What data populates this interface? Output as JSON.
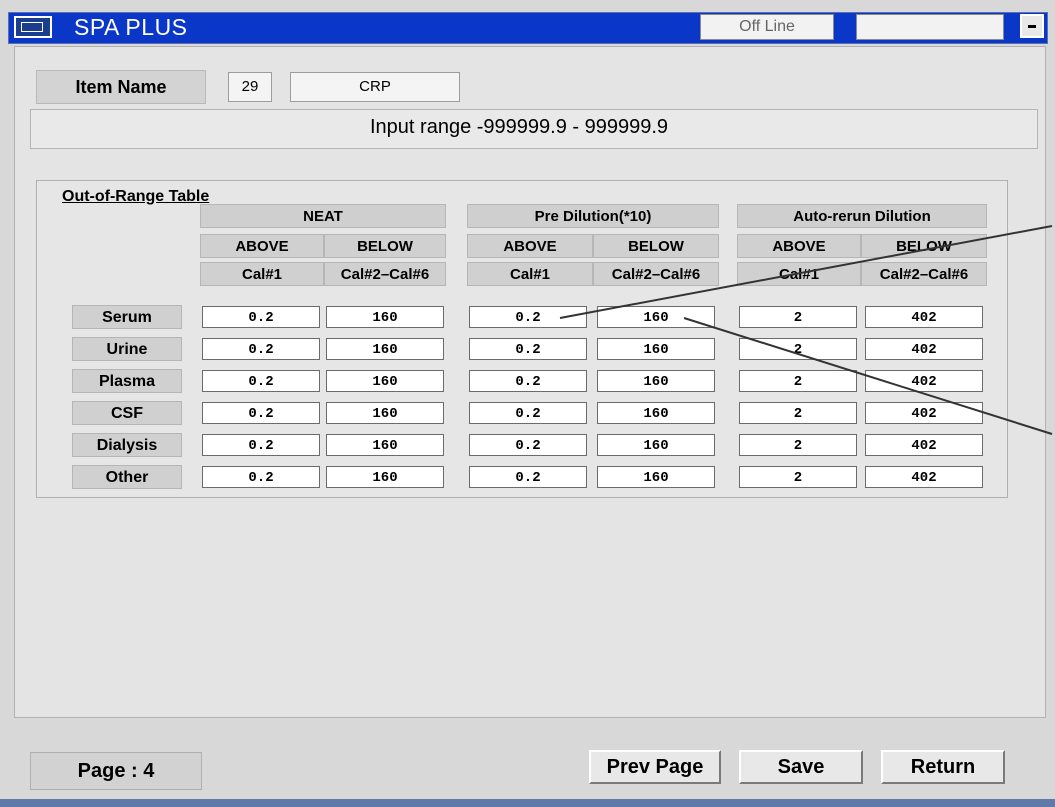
{
  "window": {
    "title": "SPA PLUS",
    "status": "Off Line"
  },
  "item": {
    "label": "Item Name",
    "number": "29",
    "name": "CRP"
  },
  "range_text": "Input range  -999999.9  -  999999.9",
  "table": {
    "title": "Out-of-Range Table",
    "groups": [
      "NEAT",
      "Pre Dilution(*10)",
      "Auto-rerun Dilution"
    ],
    "subheaders": [
      "ABOVE",
      "BELOW"
    ],
    "cal_labels": [
      "Cal#1",
      "Cal#2–Cal#6"
    ],
    "rows": [
      {
        "label": "Serum",
        "values": [
          "0.2",
          "160",
          "0.2",
          "160",
          "2",
          "402"
        ]
      },
      {
        "label": "Urine",
        "values": [
          "0.2",
          "160",
          "0.2",
          "160",
          "2",
          "402"
        ]
      },
      {
        "label": "Plasma",
        "values": [
          "0.2",
          "160",
          "0.2",
          "160",
          "2",
          "402"
        ]
      },
      {
        "label": "CSF",
        "values": [
          "0.2",
          "160",
          "0.2",
          "160",
          "2",
          "402"
        ]
      },
      {
        "label": "Dialysis",
        "values": [
          "0.2",
          "160",
          "0.2",
          "160",
          "2",
          "402"
        ]
      },
      {
        "label": "Other",
        "values": [
          "0.2",
          "160",
          "0.2",
          "160",
          "2",
          "402"
        ]
      }
    ]
  },
  "footer": {
    "page_label": "Page : 4",
    "prev_label": "Prev Page",
    "save_label": "Save",
    "return_label": "Return"
  }
}
